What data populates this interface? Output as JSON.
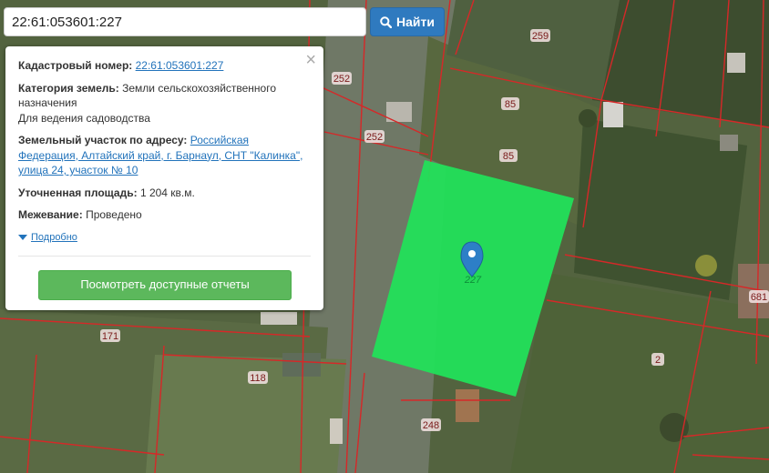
{
  "search": {
    "value": "22:61:053601:227",
    "button_label": "Найти"
  },
  "popup": {
    "close_symbol": "×",
    "cadastral_label": "Кадастровый номер:",
    "cadastral_value": "22:61:053601:227",
    "category_label": "Категория земель:",
    "category_value": "Земли сельскохозяйственного назначения",
    "category_use": "Для ведения садоводства",
    "address_label": "Земельный участок по адресу:",
    "address_value": "Российская Федерация, Алтайский край, г. Барнаул, СНТ \"Калинка\", улица 24, участок № 10",
    "area_label": "Уточненная площадь:",
    "area_value": "1 204 кв.м.",
    "survey_label": "Межевание:",
    "survey_value": "Проведено",
    "more_label": "Подробно",
    "reports_button": "Посмотреть доступные отчеты"
  },
  "map": {
    "parcel_labels": [
      "259",
      "252",
      "252",
      "85",
      "85",
      "171",
      "118",
      "248",
      "2",
      "681"
    ],
    "marker_label": "227",
    "colors": {
      "parcel_fill": "#22e05a",
      "boundary": "#d62828",
      "marker": "#2d7fc7"
    }
  },
  "icons": {
    "search": "search-icon",
    "marker": "map-marker-icon",
    "close": "close-icon",
    "expand": "caret-down-icon"
  }
}
